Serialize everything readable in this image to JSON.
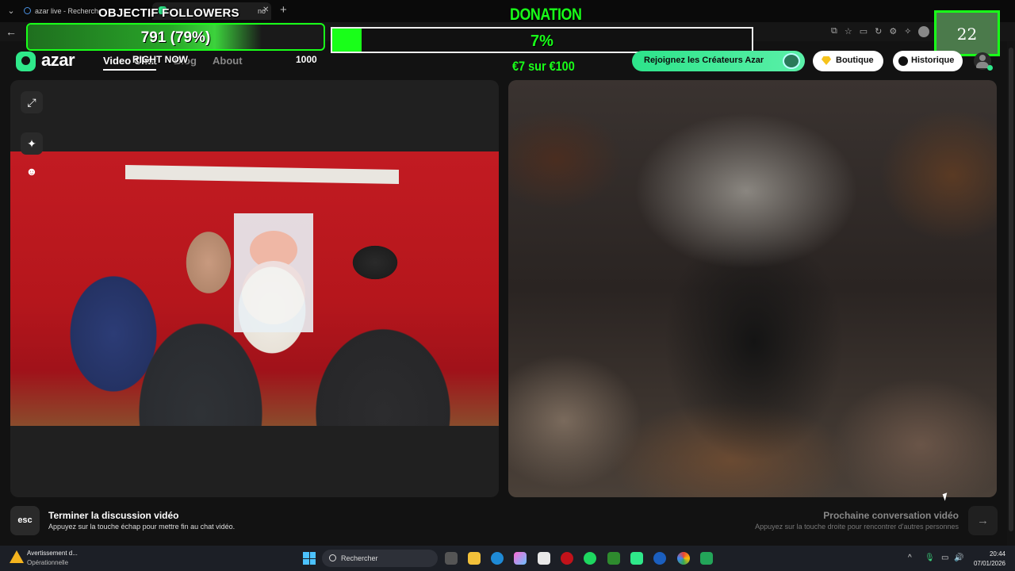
{
  "browser": {
    "tabs": [
      {
        "title": "azar live - Recherche"
      },
      {
        "title": "no"
      }
    ]
  },
  "overlay": {
    "followers": {
      "title": "OBJECTIF FOLLOWERS",
      "value_text": "791 (79%)",
      "progress": 0.79
    },
    "donation": {
      "title": "DONATION",
      "percent_text": "7%",
      "progress": 0.07,
      "subtitle": "€7 sur €100"
    },
    "counter": "22",
    "right_now": "RIGHT NOW",
    "thousand": "1000"
  },
  "azar": {
    "logo": "azar",
    "nav": {
      "video_chat": "Video Chat",
      "blog": "Blog",
      "about": "About"
    },
    "buttons": {
      "join": "Rejoignez les Créateurs Azar",
      "shop": "Boutique",
      "history": "Historique"
    }
  },
  "bottom": {
    "esc_key": "esc",
    "end_title": "Terminer la discussion vidéo",
    "end_subtitle": "Appuyez sur la touche échap pour mettre fin au chat vidéo.",
    "next_title": "Prochaine conversation vidéo",
    "next_subtitle": "Appuyez sur la touche droite pour rencontrer d'autres personnes"
  },
  "taskbar": {
    "warning_title": "Avertissement d...",
    "warning_status": "Opérationnelle",
    "search_placeholder": "Rechercher",
    "time": "20:44",
    "date": "07/01/2026"
  },
  "colors": {
    "accent_green": "#19ff19",
    "azar_green": "#2fe88a"
  }
}
